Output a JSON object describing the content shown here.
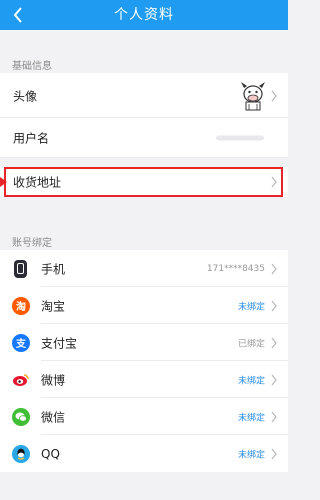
{
  "header": {
    "title": "个人资料",
    "back_icon": "chevron-left-icon"
  },
  "basic": {
    "section_label": "基础信息",
    "avatar_label": "头像",
    "username_label": "用户名",
    "address_label": "收货地址"
  },
  "accounts": {
    "section_label": "账号绑定",
    "items": [
      {
        "label": "手机",
        "value": "171****8435",
        "status": "bound",
        "icon": "phone-icon",
        "color": "#2b2b33"
      },
      {
        "label": "淘宝",
        "value": "未绑定",
        "status": "unbound",
        "icon": "taobao-icon",
        "color": "#ff5a00"
      },
      {
        "label": "支付宝",
        "value": "已绑定",
        "status": "bound",
        "icon": "alipay-icon",
        "color": "#1677ff"
      },
      {
        "label": "微博",
        "value": "未绑定",
        "status": "unbound",
        "icon": "weibo-icon",
        "color": "#f0a24a"
      },
      {
        "label": "微信",
        "value": "未绑定",
        "status": "unbound",
        "icon": "wechat-icon",
        "color": "#3fbe36"
      },
      {
        "label": "QQ",
        "value": "未绑定",
        "status": "unbound",
        "icon": "qq-icon",
        "color": "#2aa7e6"
      }
    ]
  },
  "colors": {
    "header": "#1f9cf2",
    "highlight": "#e5252a",
    "link": "#2a8ce6"
  }
}
